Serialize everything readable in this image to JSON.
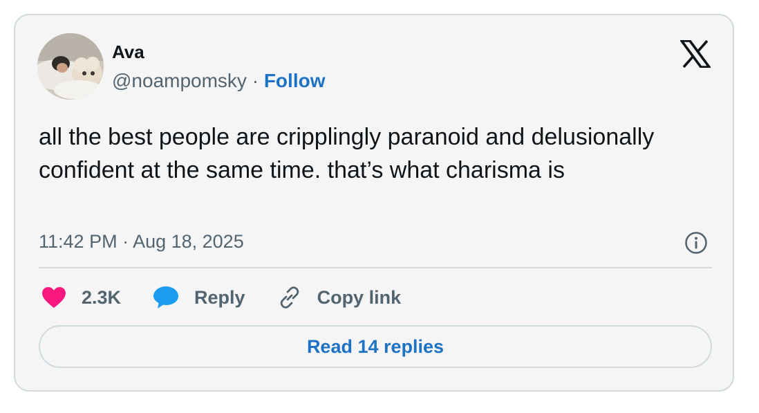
{
  "author": {
    "name": "Ava",
    "handle": "@noampomsky",
    "separator": "·",
    "follow_label": "Follow"
  },
  "tweet": {
    "text": "all the best people are cripplingly paranoid and delusionally confident at the same time. that’s what charisma is",
    "timestamp": "11:42 PM · Aug 18, 2025"
  },
  "actions": {
    "like_count": "2.3K",
    "reply_label": "Reply",
    "copy_link_label": "Copy link"
  },
  "read_replies_label": "Read 14 replies",
  "icons": {
    "brand": "x-logo-icon",
    "info": "info-icon",
    "like": "heart-icon",
    "reply": "speech-bubble-icon",
    "copy": "link-icon"
  },
  "colors": {
    "card_background": "#f5f5f5",
    "border": "#cfd9de",
    "text_primary": "#0f1419",
    "text_secondary": "#536471",
    "link_blue": "#1d72c4",
    "heart_pink": "#f91880",
    "reply_blue": "#1d9bf0"
  }
}
